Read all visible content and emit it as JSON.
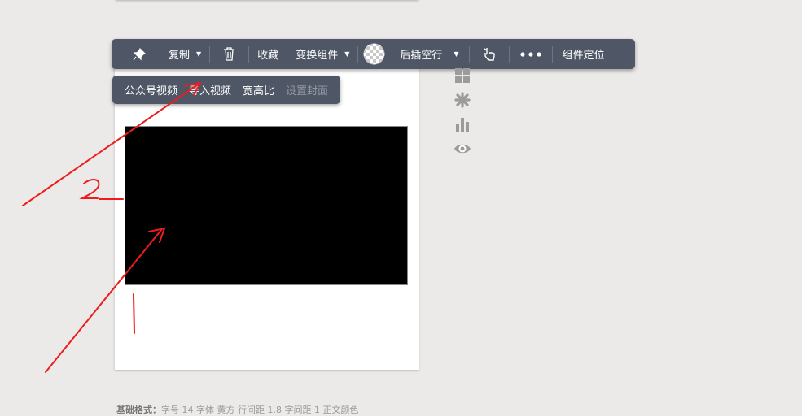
{
  "toolbar": {
    "copy_label": "复制",
    "favorite_label": "收藏",
    "transform_label": "变换组件",
    "insert_row_label": "后插空行",
    "locate_label": "组件定位"
  },
  "subbar": {
    "items": [
      "公众号视频",
      "导入视频",
      "宽高比",
      "设置封面"
    ]
  },
  "footer": {
    "label": "基础格式：",
    "text": "字号 14 字体 黄方 行间距 1.8 字间距 1 正文颜色"
  },
  "annotations": {
    "mark_1": "1",
    "mark_2": "2"
  },
  "colors": {
    "toolbar_bg": "#4f5666",
    "annotation_red": "#ee1c1c",
    "disabled_text": "#969aa4"
  },
  "icons": [
    "pin-icon",
    "trash-icon",
    "transparent-swatch-icon",
    "pointer-hand-icon",
    "more-dots-icon",
    "grid-icon",
    "asterisk-icon",
    "bar-chart-icon",
    "eye-icon"
  ]
}
